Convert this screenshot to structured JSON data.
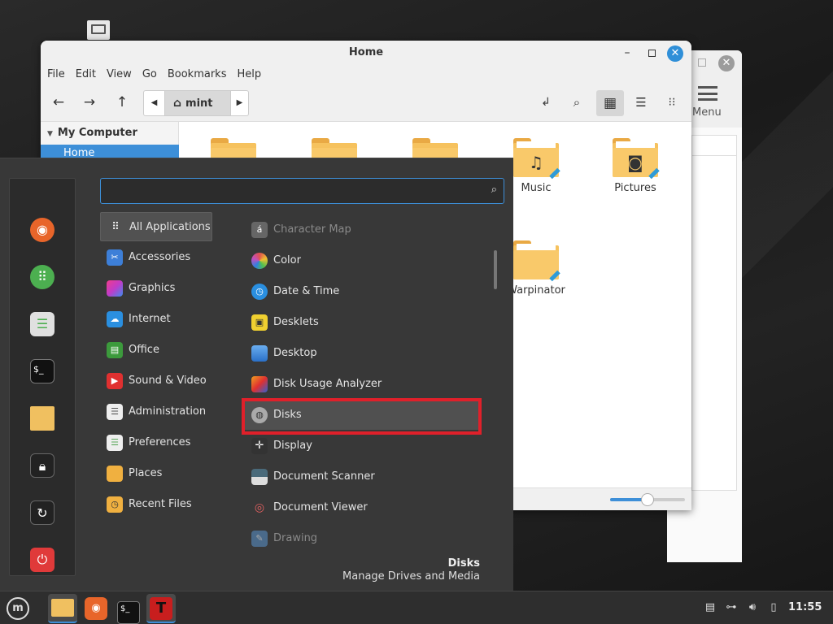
{
  "file_manager": {
    "title": "Home",
    "menubar": [
      "File",
      "Edit",
      "View",
      "Go",
      "Bookmarks",
      "Help"
    ],
    "path": "mint",
    "sidebar": {
      "header": "My Computer",
      "selected": "Home"
    },
    "folders": [
      {
        "label": "",
        "icon": "folder-icon"
      },
      {
        "label": "",
        "icon": "folder-documents-icon"
      },
      {
        "label": "",
        "icon": "folder-downloads-icon"
      },
      {
        "label": "Music",
        "icon": "folder-music-icon"
      },
      {
        "label": "Pictures",
        "icon": "folder-pictures-icon"
      },
      {
        "label": "Warpinator",
        "icon": "folder-warpinator-icon"
      }
    ],
    "zoom_level": 0.5
  },
  "back_window": {
    "menu_label": "Menu"
  },
  "app_menu": {
    "search_placeholder": "",
    "categories": [
      {
        "label": "All Applications",
        "color": "#515151"
      },
      {
        "label": "Accessories",
        "color": "#3d7fd8"
      },
      {
        "label": "Graphics",
        "color": "#c03cc8"
      },
      {
        "label": "Internet",
        "color": "#2a8fe0"
      },
      {
        "label": "Office",
        "color": "#3c9a3c"
      },
      {
        "label": "Sound & Video",
        "color": "#e03030"
      },
      {
        "label": "Administration",
        "color": "#888888"
      },
      {
        "label": "Preferences",
        "color": "#5aa85a"
      },
      {
        "label": "Places",
        "color": "#f0b040"
      },
      {
        "label": "Recent Files",
        "color": "#f0b040"
      }
    ],
    "apps": [
      {
        "label": "Character Map",
        "dim": true,
        "color": "#666666",
        "glyph": "á"
      },
      {
        "label": "Color",
        "dim": false,
        "color": "#e05050",
        "glyph": "◉"
      },
      {
        "label": "Date & Time",
        "dim": false,
        "color": "#2a8fe0",
        "glyph": "◷"
      },
      {
        "label": "Desklets",
        "dim": false,
        "color": "#f0d030",
        "glyph": "▣"
      },
      {
        "label": "Desktop",
        "dim": false,
        "color": "#4a90e0",
        "glyph": "▬"
      },
      {
        "label": "Disk Usage Analyzer",
        "dim": false,
        "color": "#e06a20",
        "glyph": "◔"
      },
      {
        "label": "Disks",
        "dim": false,
        "color": "#999999",
        "glyph": "◍"
      },
      {
        "label": "Display",
        "dim": false,
        "color": "#444444",
        "glyph": "✛"
      },
      {
        "label": "Document Scanner",
        "dim": false,
        "color": "#4a6a7a",
        "glyph": "▭"
      },
      {
        "label": "Document Viewer",
        "dim": false,
        "color": "#c84848",
        "glyph": "◎"
      },
      {
        "label": "Drawing",
        "dim": true,
        "color": "#4a6a8a",
        "glyph": "✎"
      }
    ],
    "selected_app": {
      "title": "Disks",
      "description": "Manage Drives and Media"
    }
  },
  "taskbar": {
    "clock": "11:55"
  },
  "colors": {
    "accent": "#3d8fd8",
    "highlight_border": "#e0202a"
  }
}
